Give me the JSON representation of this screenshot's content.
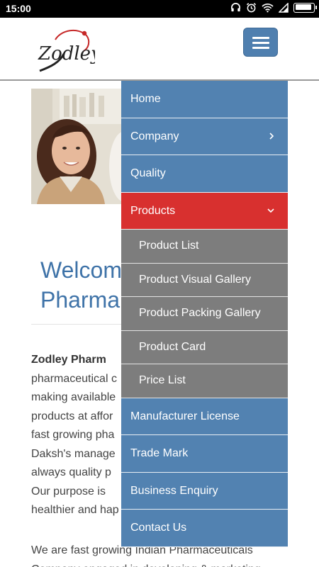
{
  "status_bar": {
    "time": "15:00",
    "icons": [
      "headphones-icon",
      "alarm-icon",
      "wifi-icon",
      "signal-icon",
      "battery-icon"
    ]
  },
  "header": {
    "logo_text": "Zodley",
    "menu_button": "hamburger-menu-icon"
  },
  "colors": {
    "menu_blue": "#5282b1",
    "menu_active_red": "#d8302f",
    "submenu_gray": "#7d7d7d",
    "title_blue": "#3f73a8"
  },
  "page": {
    "welcome_line1": "Welcome",
    "welcome_line2": "Pharma",
    "para1_bold": "Zodley Pharm",
    "para1_lines": [
      "pharmaceutical c",
      "making available",
      "products at affor",
      "fast growing pha",
      "Daksh's manage",
      "always quality p",
      "Our purpose is",
      "healthier and hap"
    ],
    "para2_line1": "We are fast growing Indian Pharmaceuticals",
    "para2_line2": "Company engaged in developing & marketing"
  },
  "menu": {
    "items": [
      {
        "label": "Home"
      },
      {
        "label": "Company"
      },
      {
        "label": "Quality"
      },
      {
        "label": "Products"
      },
      {
        "label": "Manufacturer License"
      },
      {
        "label": "Trade Mark"
      },
      {
        "label": "Business Enquiry"
      },
      {
        "label": "Contact Us"
      }
    ],
    "products_submenu": [
      {
        "label": "Product List"
      },
      {
        "label": "Product Visual Gallery"
      },
      {
        "label": "Product Packing Gallery"
      },
      {
        "label": "Product Card"
      },
      {
        "label": "Price List"
      }
    ]
  }
}
